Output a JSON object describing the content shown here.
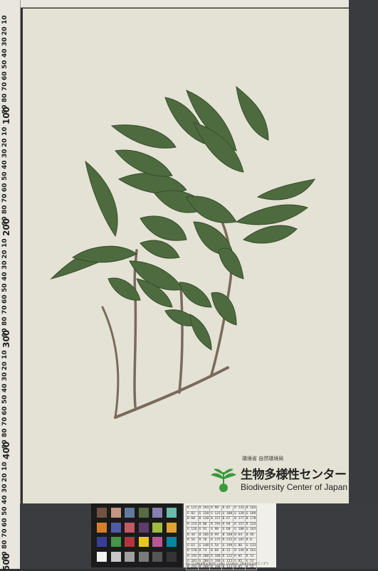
{
  "ruler": {
    "labels": [
      "10",
      "20",
      "30",
      "40",
      "50",
      "60",
      "70",
      "80",
      "90",
      "100",
      "10",
      "20",
      "30",
      "40",
      "50",
      "60",
      "70",
      "80",
      "90",
      "200",
      "10",
      "20",
      "30",
      "40",
      "50",
      "60",
      "70",
      "80",
      "90",
      "300",
      "10",
      "20",
      "30",
      "40",
      "50",
      "60",
      "70",
      "80",
      "90",
      "400",
      "10",
      "20",
      "30",
      "40",
      "50",
      "60",
      "70",
      "80",
      "90",
      "500"
    ]
  },
  "logo": {
    "small_text": "環境省 自然環境局",
    "title_jp": "生物多様性センター",
    "title_en": "Biodiversity Center of Japan"
  },
  "color_checker": {
    "patches": [
      "#735244",
      "#c29682",
      "#627a9d",
      "#576c43",
      "#8580b1",
      "#67bdaa",
      "#d67e2c",
      "#505ba6",
      "#c15a63",
      "#5e3c6c",
      "#9dbc40",
      "#e0a32e",
      "#383d96",
      "#469449",
      "#af363c",
      "#e7c71f",
      "#bb5695",
      "#0885a1",
      "#f3f3f2",
      "#c8c8c8",
      "#a0a0a0",
      "#7a7a7a",
      "#555555",
      "#343434"
    ]
  },
  "table_card": {
    "rows": [
      [
        "R 115",
        "R 194",
        "R 98",
        "R 87",
        "R 133",
        "R 103"
      ],
      [
        "G 82",
        "G 150",
        "G 122",
        "G 108",
        "G 128",
        "G 189"
      ],
      [
        "B 68",
        "B 130",
        "B 157",
        "B 67",
        "B 177",
        "B 170"
      ],
      [
        "R 214",
        "R 80",
        "R 193",
        "R 94",
        "R 157",
        "R 224"
      ],
      [
        "G 126",
        "G 91",
        "G 90",
        "G 60",
        "G 188",
        "G 163"
      ],
      [
        "B 44",
        "B 166",
        "B 99",
        "B 108",
        "B 64",
        "B 46"
      ],
      [
        "R 56",
        "R 70",
        "R 175",
        "R 231",
        "R 187",
        "R 8"
      ],
      [
        "G 61",
        "G 148",
        "G 54",
        "G 199",
        "G 86",
        "G 133"
      ],
      [
        "B 150",
        "B 73",
        "B 60",
        "B 31",
        "B 149",
        "B 161"
      ],
      [
        "R 243",
        "R 200",
        "R 160",
        "R 122",
        "R 85",
        "R 52"
      ],
      [
        "G 243",
        "G 200",
        "G 160",
        "G 122",
        "G 85",
        "G 52"
      ],
      [
        "B 242",
        "B 200",
        "B 160",
        "B 121",
        "B 85",
        "B 52"
      ]
    ],
    "caption": "by GretagMacbeth color checker (Illuminant C / 2°)"
  }
}
